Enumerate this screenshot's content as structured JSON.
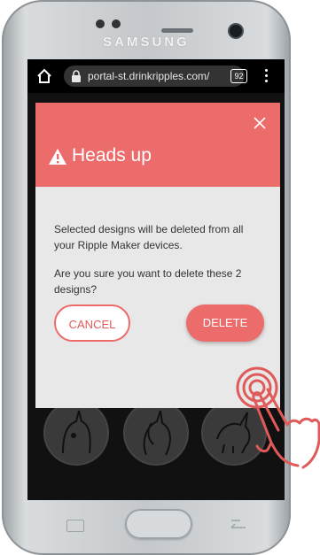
{
  "device": {
    "brand": "SAMSUNG"
  },
  "browser": {
    "url": "portal-st.drinkripples.com/",
    "tab_count": "92",
    "icons": [
      "home-icon",
      "lock-icon",
      "tabs-icon",
      "more-menu-icon"
    ]
  },
  "dialog": {
    "title": "Heads up",
    "message_1": "Selected designs will be deleted from all your Ripple Maker devices.",
    "message_2": "Are you sure you want to delete these 2 designs?",
    "cancel_label": "CANCEL",
    "delete_label": "DELETE",
    "icons": [
      "warning-icon",
      "close-icon"
    ]
  },
  "colors": {
    "accent": "#ec6b6b",
    "dialog_bg": "#e8e8e8",
    "page_bg": "#111111"
  }
}
